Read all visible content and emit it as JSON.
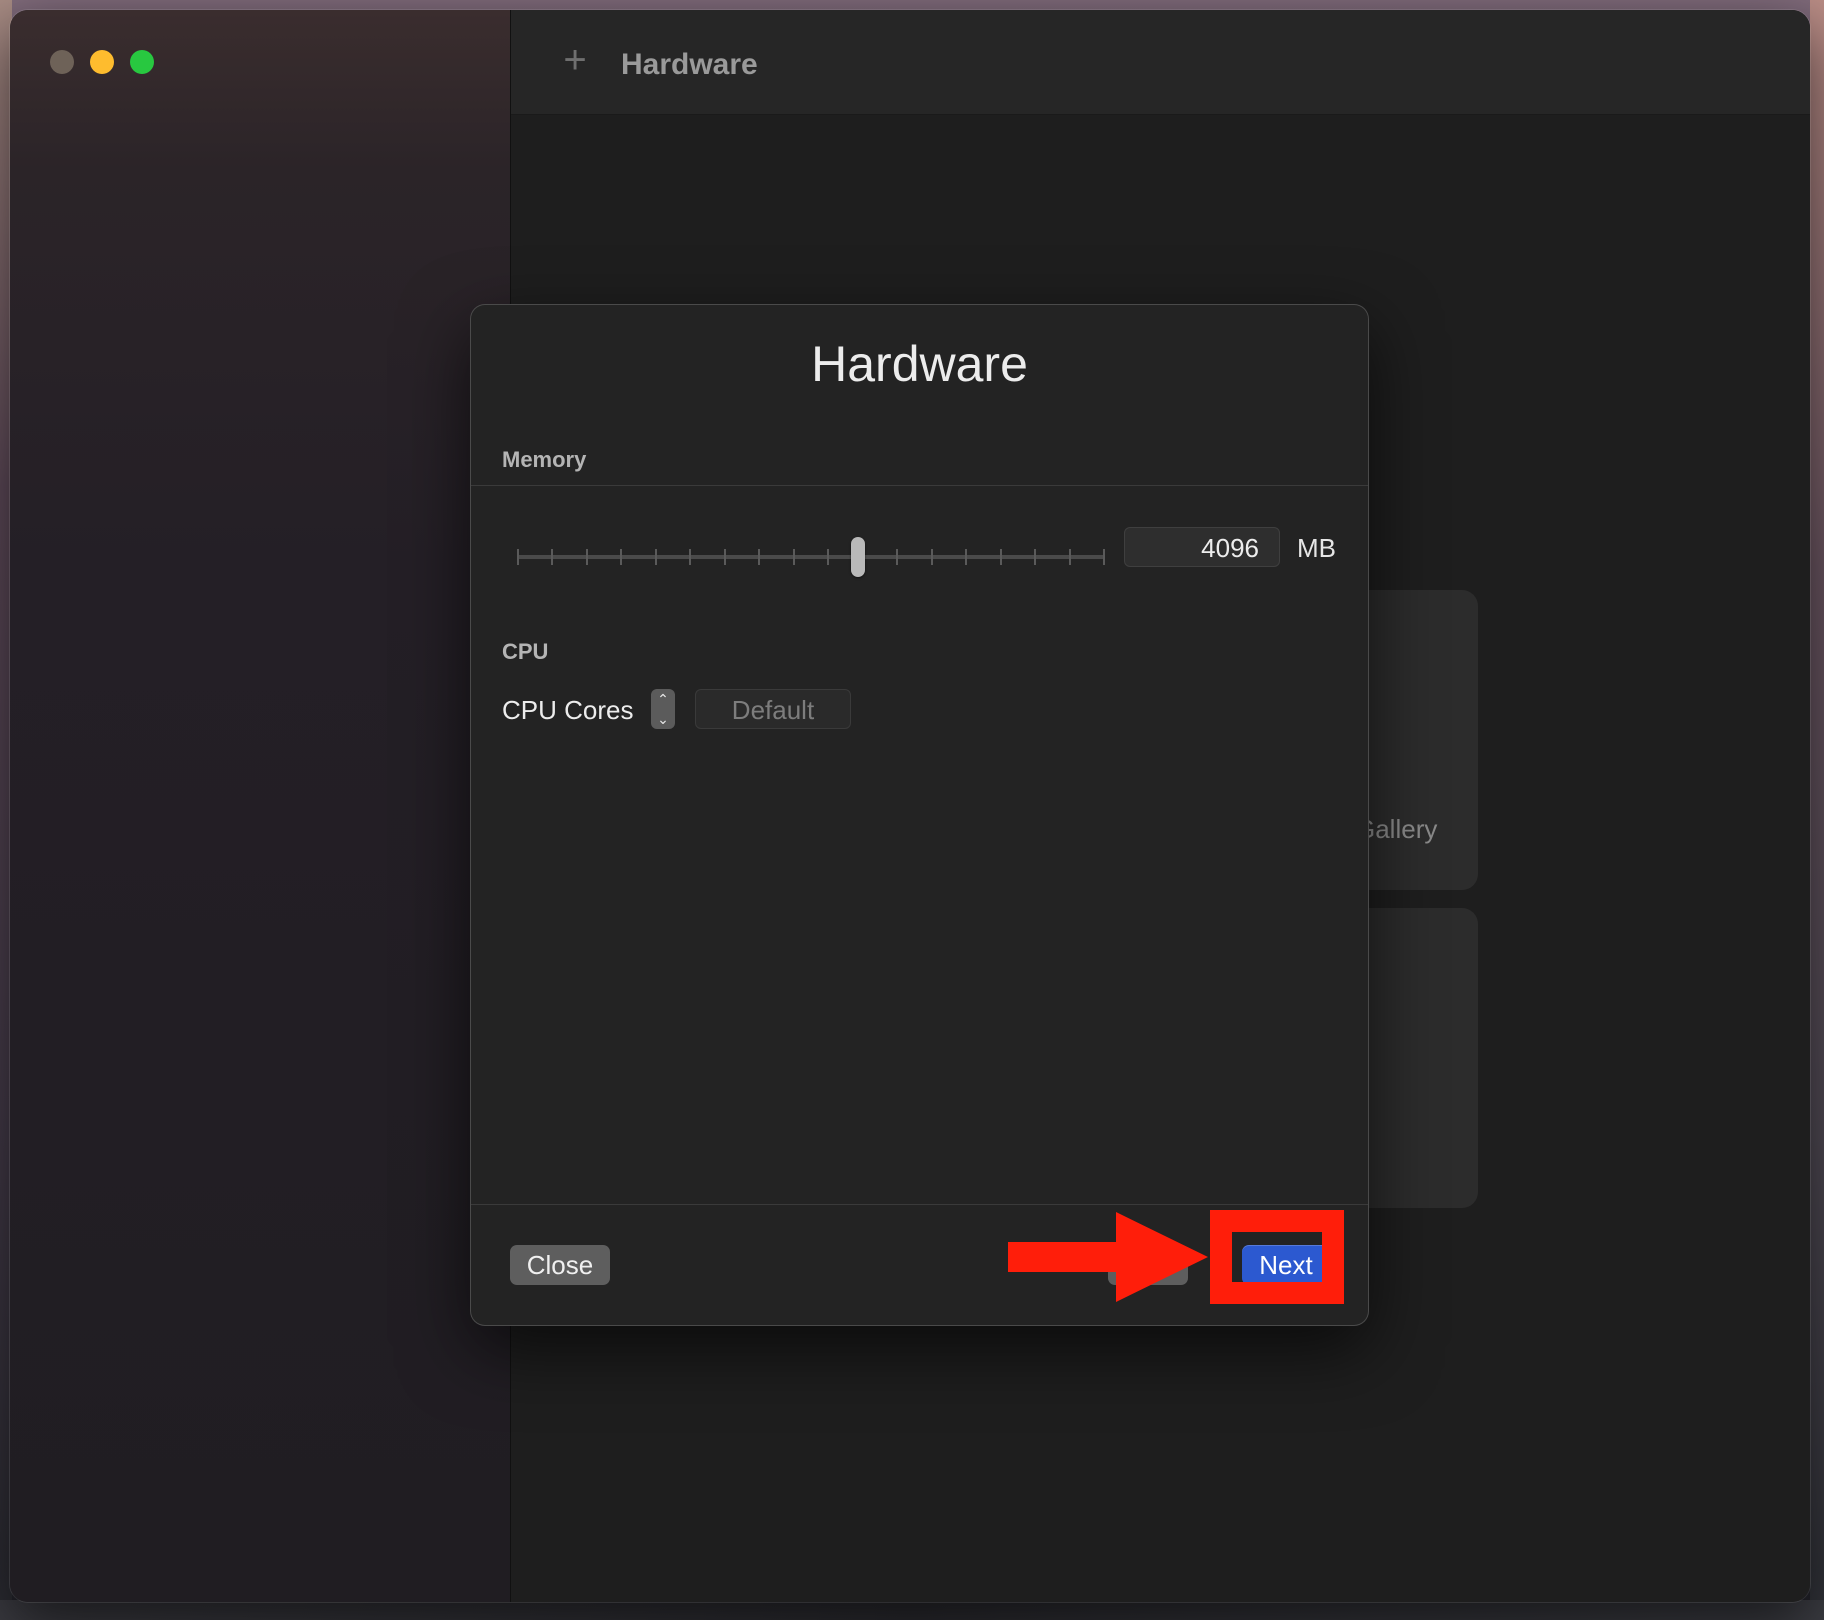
{
  "window": {
    "toolbar_title": "Hardware",
    "toolbar_add_icon": "plus-icon"
  },
  "background_cards": {
    "card1_label": "Gallery"
  },
  "dialog": {
    "title": "Hardware",
    "memory": {
      "section_label": "Memory",
      "slider_value_fraction": 0.58,
      "slider_tick_count": 18,
      "value": "4096",
      "unit": "MB"
    },
    "cpu": {
      "section_label": "CPU",
      "cores_label": "CPU Cores",
      "cores_value": "Default"
    },
    "buttons": {
      "close_label": "Close",
      "next_label": "Next"
    }
  },
  "annotations": {
    "highlight_color": "#ff1e0a",
    "arrow_icon": "red-arrow-right-icon"
  },
  "colors": {
    "accent": "#2c59d0",
    "close_light": "#6e6258",
    "minimize_light": "#febc2e",
    "zoom_light": "#28c840"
  }
}
